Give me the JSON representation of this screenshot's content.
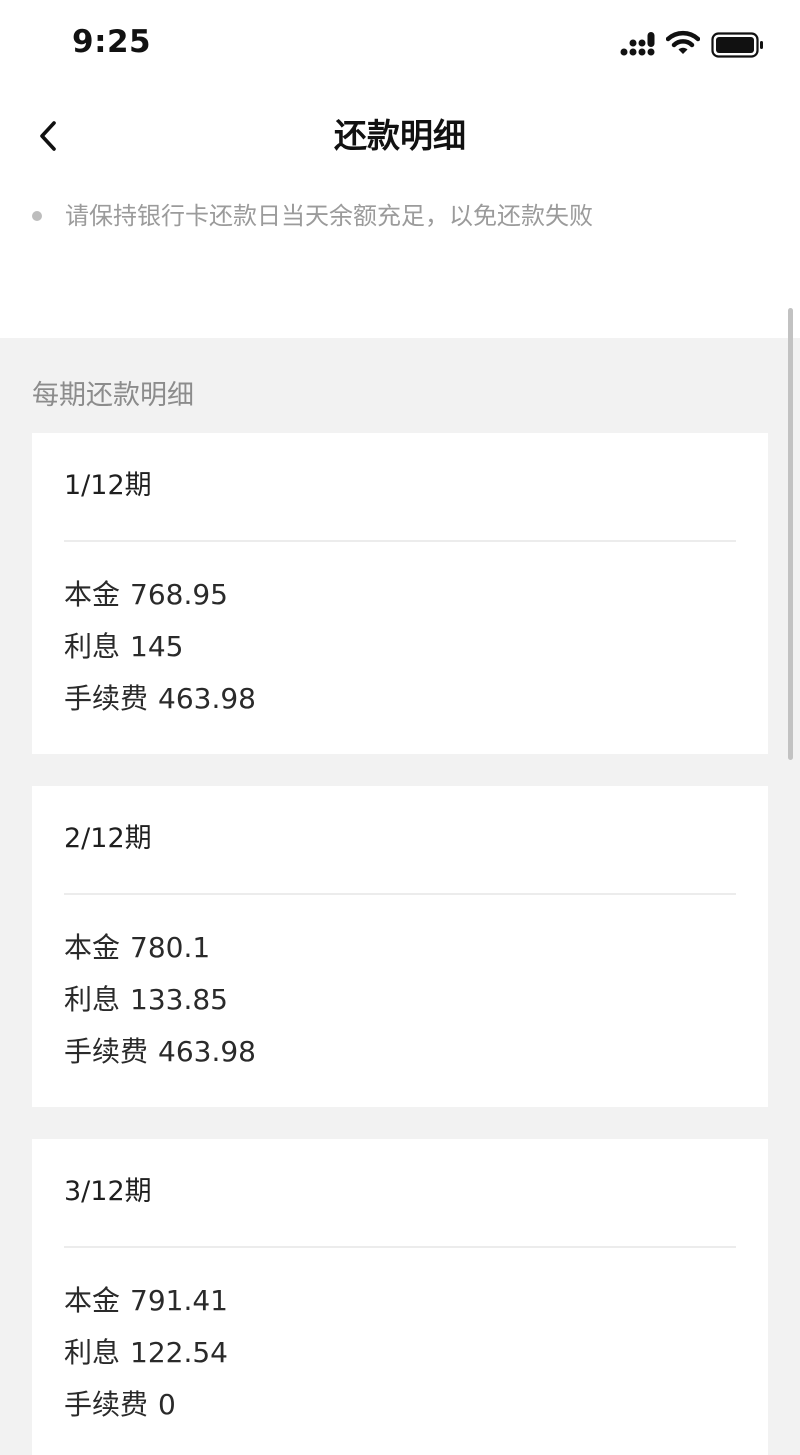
{
  "status_bar": {
    "time": "9:25"
  },
  "nav": {
    "title": "还款明细"
  },
  "notice": {
    "text": "请保持银行卡还款日当天余额充足，以免还款失败"
  },
  "section": {
    "label": "每期还款明细"
  },
  "installments": [
    {
      "period": "1/12期",
      "principal_label": "本金",
      "principal": "768.95",
      "interest_label": "利息",
      "interest": "145",
      "fee_label": "手续费",
      "fee": "463.98"
    },
    {
      "period": "2/12期",
      "principal_label": "本金",
      "principal": "780.1",
      "interest_label": "利息",
      "interest": "133.85",
      "fee_label": "手续费",
      "fee": "463.98"
    },
    {
      "period": "3/12期",
      "principal_label": "本金",
      "principal": "791.41",
      "interest_label": "利息",
      "interest": "122.54",
      "fee_label": "手续费",
      "fee": "0"
    }
  ]
}
